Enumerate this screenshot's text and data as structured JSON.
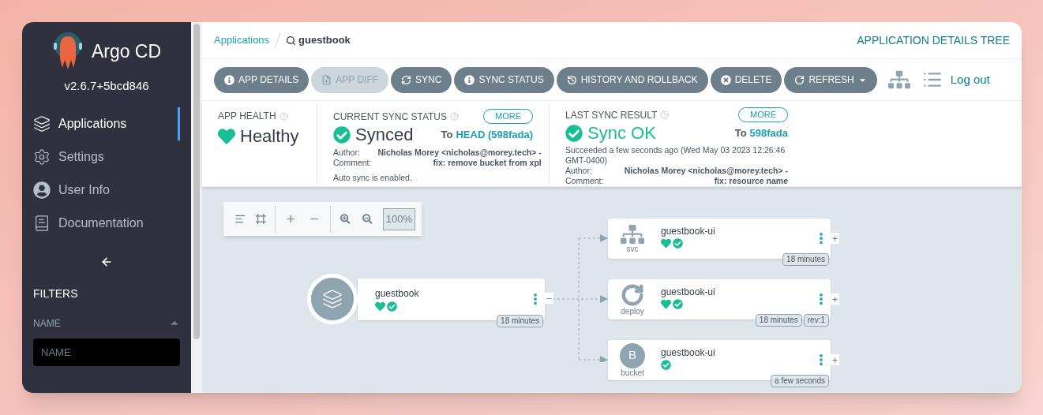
{
  "sidebar": {
    "logo_text": "Argo CD",
    "version": "v2.6.7+5bcd846",
    "nav": [
      {
        "kind": "applications",
        "label": "Applications",
        "selected": true
      },
      {
        "kind": "settings",
        "label": "Settings",
        "selected": false
      },
      {
        "kind": "user",
        "label": "User Info",
        "selected": false
      },
      {
        "kind": "docs",
        "label": "Documentation",
        "selected": false
      }
    ],
    "filters": {
      "title": "FILTERS",
      "name_label": "NAME",
      "name_placeholder": "NAME"
    }
  },
  "breadcrumb": {
    "parent": "Applications",
    "current": "guestbook"
  },
  "view_title": "APPLICATION DETAILS TREE",
  "toolbar": [
    {
      "kind": "info",
      "label": "APP DETAILS",
      "disabled": false
    },
    {
      "kind": "diff",
      "label": "APP DIFF",
      "disabled": true
    },
    {
      "kind": "sync",
      "label": "SYNC",
      "disabled": false
    },
    {
      "kind": "info",
      "label": "SYNC STATUS",
      "disabled": false
    },
    {
      "kind": "history",
      "label": "HISTORY AND ROLLBACK",
      "disabled": false
    },
    {
      "kind": "delete",
      "label": "DELETE",
      "disabled": false
    },
    {
      "kind": "refresh",
      "label": "REFRESH",
      "disabled": false
    }
  ],
  "logout": "Log out",
  "app_health": {
    "title": "APP HEALTH",
    "status": "Healthy"
  },
  "current_sync": {
    "title": "CURRENT SYNC STATUS",
    "more": "MORE",
    "status": "Synced",
    "to": "To",
    "revision": "HEAD (598fada)",
    "author_label": "Author:",
    "author": "Nicholas Morey <nicholas@morey.tech> -",
    "comment_label": "Comment:",
    "comment": "fix: remove bucket from xpl",
    "note": "Auto sync is enabled."
  },
  "last_sync": {
    "title": "LAST SYNC RESULT",
    "more": "MORE",
    "status": "Sync OK",
    "to": "To",
    "revision": "598fada",
    "message": "Succeeded a few seconds ago (Wed May 03 2023 12:26:46 GMT-0400)",
    "author_label": "Author:",
    "author": "Nicholas Morey <nicholas@morey.tech> -",
    "comment_label": "Comment:",
    "comment": "fix: resource name"
  },
  "graph": {
    "zoom": "100%",
    "root": {
      "name": "guestbook",
      "healthy": true,
      "synced": true,
      "expanded": true,
      "badges": [
        "18 minutes"
      ]
    },
    "children": [
      {
        "kind": "svc",
        "type_label": "svc",
        "name": "guestbook-ui",
        "healthy": true,
        "synced": true,
        "expanded": false,
        "badges": [
          "18 minutes"
        ]
      },
      {
        "kind": "deploy",
        "type_label": "deploy",
        "name": "guestbook-ui",
        "healthy": true,
        "synced": true,
        "expanded": false,
        "badges": [
          "18 minutes",
          "rev:1"
        ]
      },
      {
        "kind": "bucket",
        "letter": "B",
        "type_label": "bucket",
        "name": "guestbook-ui",
        "healthy": false,
        "synced": true,
        "expanded": false,
        "badges": [
          "a few seconds"
        ]
      }
    ]
  }
}
